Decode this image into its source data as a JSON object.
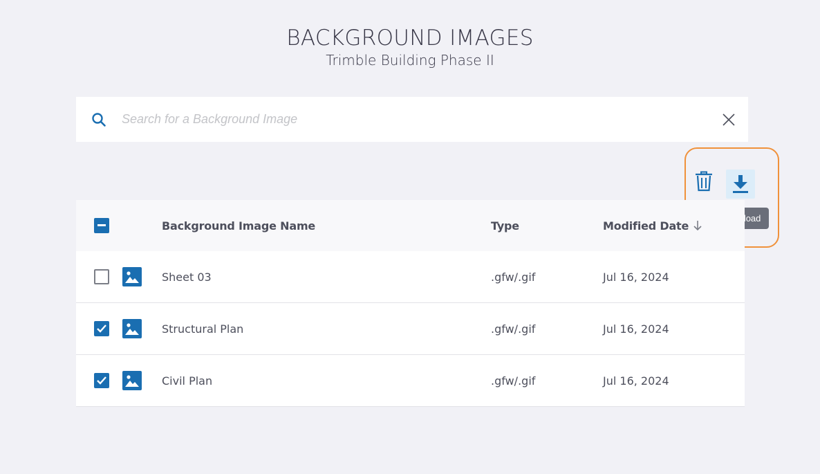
{
  "header": {
    "title": "BACKGROUND IMAGES",
    "subtitle": "Trimble Building Phase II"
  },
  "search": {
    "placeholder": "Search for a Background Image",
    "value": ""
  },
  "toolbar": {
    "tooltip": "Download"
  },
  "table": {
    "columns": {
      "name": "Background Image Name",
      "type": "Type",
      "modified": "Modified Date"
    },
    "rows": [
      {
        "name": "Sheet 03",
        "type": ".gfw/.gif",
        "modified": "Jul 16, 2024",
        "checked": false
      },
      {
        "name": "Structural Plan",
        "type": ".gfw/.gif",
        "modified": "Jul 16, 2024",
        "checked": true
      },
      {
        "name": "Civil Plan",
        "type": ".gfw/.gif",
        "modified": "Jul 16, 2024",
        "checked": true
      }
    ]
  },
  "colors": {
    "accent": "#1a6eb1",
    "highlight": "#f0913a",
    "background": "#f1f1f6"
  }
}
